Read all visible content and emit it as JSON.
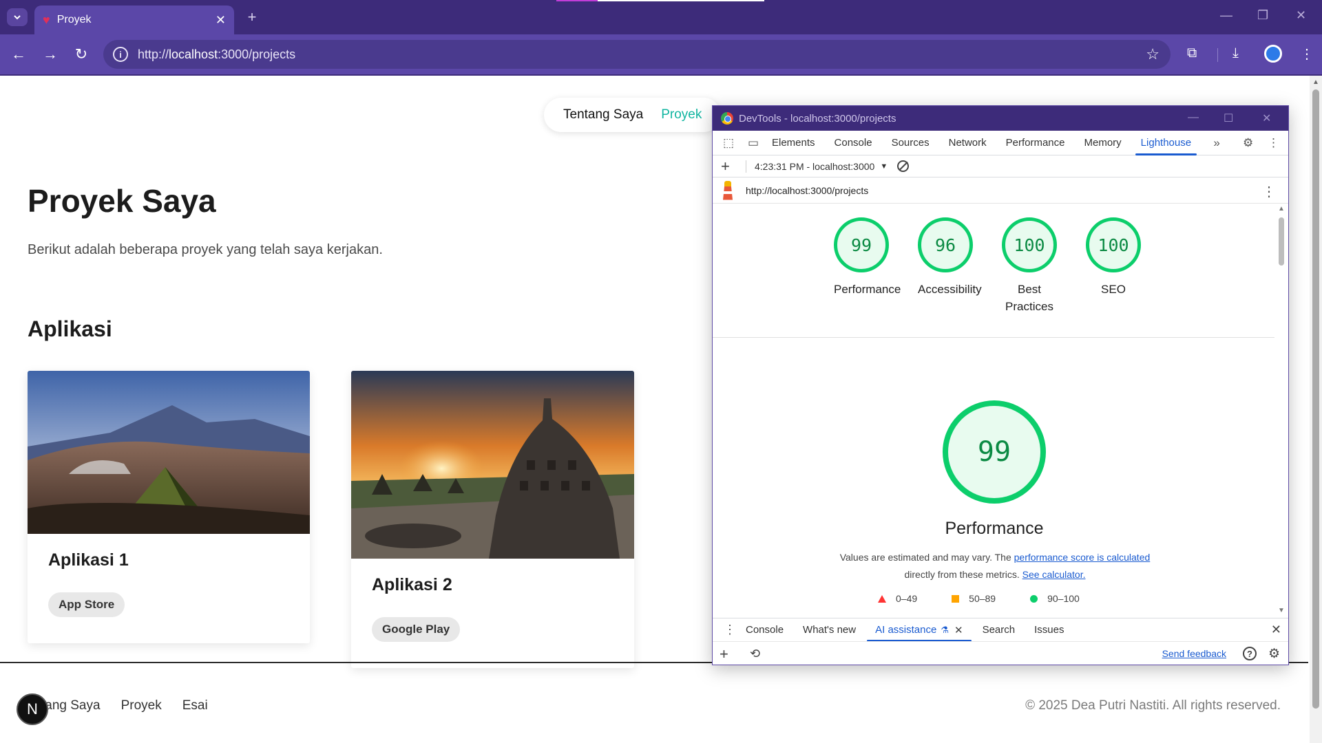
{
  "browser": {
    "tab_title": "Proyek",
    "url_prefix": "http://",
    "url_host": "localhost",
    "url_rest": ":3000/projects"
  },
  "site": {
    "nav": [
      "Tentang Saya",
      "Proyek"
    ],
    "title": "Proyek Saya",
    "description": "Berikut adalah beberapa proyek yang telah saya kerjakan.",
    "section_title": "Aplikasi",
    "cards": [
      {
        "title": "Aplikasi 1",
        "badge": "App Store"
      },
      {
        "title": "Aplikasi 2",
        "badge": "Google Play"
      }
    ],
    "footer_links": [
      "tang Saya",
      "Proyek",
      "Esai"
    ],
    "footer_copy": "© 2025 Dea Putri Nastiti. All rights reserved.",
    "next_badge": "N"
  },
  "devtools": {
    "window_title": "DevTools - localhost:3000/projects",
    "tabs": [
      "Elements",
      "Console",
      "Sources",
      "Network",
      "Performance",
      "Memory",
      "Lighthouse"
    ],
    "report_label": "4:23:31 PM - localhost:3000",
    "report_url": "http://localhost:3000/projects",
    "scores": [
      {
        "score": "99",
        "label": "Performance"
      },
      {
        "score": "96",
        "label": "Accessibility"
      },
      {
        "score": "100",
        "label": "Best Practices"
      },
      {
        "score": "100",
        "label": "SEO"
      }
    ],
    "main_score": "99",
    "main_title": "Performance",
    "desc_text1": "Values are estimated and may vary. The ",
    "desc_link1": "performance score is calculated",
    "desc_text2": "directly from these metrics. ",
    "desc_link2": "See calculator.",
    "legend": [
      "0–49",
      "50–89",
      "90–100"
    ],
    "drawer_tabs": [
      "Console",
      "What's new",
      "AI assistance",
      "Search",
      "Issues"
    ],
    "send_feedback": "Send feedback"
  },
  "colors": {
    "accent": "#10b5a0",
    "score_good": "#0cce6b",
    "chrome": "#5b47a8"
  }
}
